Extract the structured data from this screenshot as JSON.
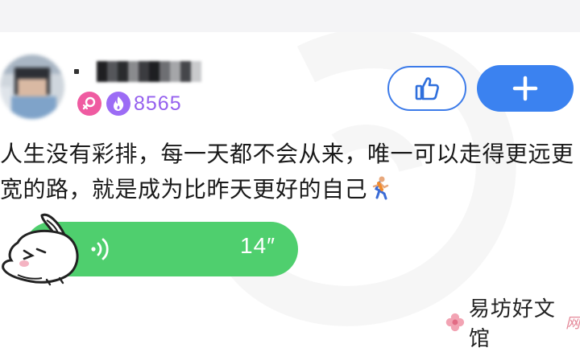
{
  "user": {
    "fans_count": "8565"
  },
  "icons": {
    "female_badge": "female-symbol-icon",
    "fire_badge": "flame-icon",
    "like": "thumbs-up-icon",
    "follow": "plus-icon",
    "voice": "sound-wave-icon",
    "sticker": "bunny-sticker",
    "emoji": "runner-emoji"
  },
  "post": {
    "line1": "人生没有彩排，每一天都不会从来，唯一可以走得更远更",
    "line2": "宽的路，就是成为比昨天更好的自己"
  },
  "voice_message": {
    "duration": "14″"
  },
  "watermark": {
    "site_name": "易坊好文馆",
    "suffix": "网"
  },
  "colors": {
    "accent_blue": "#3b82f0",
    "voice_green": "#4fcf6e",
    "fans_purple": "#9560ee",
    "female_pink": "#ef5ba1"
  }
}
